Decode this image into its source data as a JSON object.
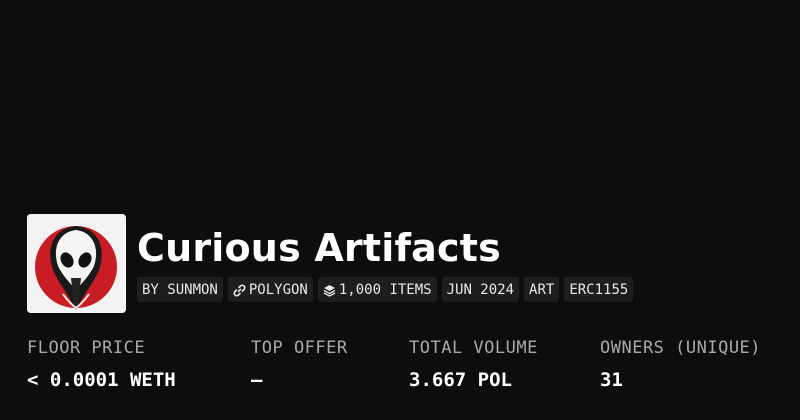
{
  "collection": {
    "title": "Curious Artifacts",
    "tags": [
      {
        "label": "BY SUNMON",
        "icon": null
      },
      {
        "label": "POLYGON",
        "icon": "link-icon"
      },
      {
        "label": "1,000 ITEMS",
        "icon": "layers-icon"
      },
      {
        "label": "JUN 2024",
        "icon": null
      },
      {
        "label": "ART",
        "icon": null
      },
      {
        "label": "ERC1155",
        "icon": null
      }
    ]
  },
  "stats": [
    {
      "label": "FLOOR PRICE",
      "value": "< 0.0001 WETH"
    },
    {
      "label": "TOP OFFER",
      "value": "—"
    },
    {
      "label": "TOTAL VOLUME",
      "value": "3.667 POL"
    },
    {
      "label": "OWNERS (UNIQUE)",
      "value": "31"
    }
  ],
  "colors": {
    "background": "#0d0d0d",
    "tag_background": "#1e1e1e",
    "label_gray": "#a9a9a9",
    "avatar_red": "#c81d25"
  }
}
